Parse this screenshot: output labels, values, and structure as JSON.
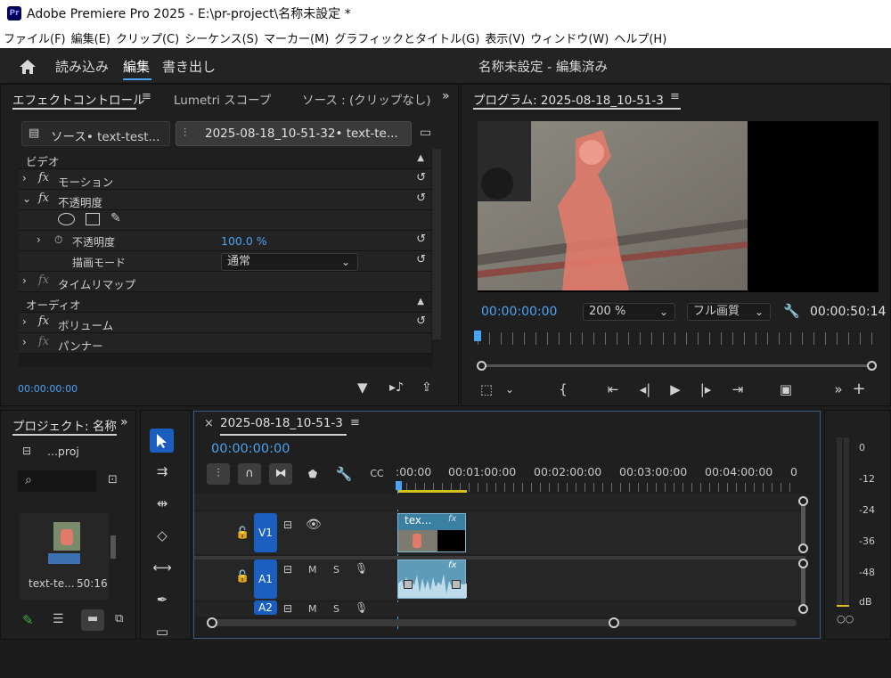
{
  "window": {
    "logo": "Pr",
    "title": "Adobe Premiere Pro 2025 - E:\\pr-project\\名称未設定 *"
  },
  "menu": [
    "ファイル(F)",
    "編集(E)",
    "クリップ(C)",
    "シーケンス(S)",
    "マーカー(M)",
    "グラフィックとタイトル(G)",
    "表示(V)",
    "ウィンドウ(W)",
    "ヘルプ(H)"
  ],
  "workspace": {
    "tabs": [
      "読み込み",
      "編集",
      "書き出し"
    ],
    "active_tab": "編集",
    "project_title": "名称未設定 - 編集済み"
  },
  "effect_controls": {
    "tabs": [
      "エフェクトコントロール",
      "Lumetri スコープ",
      "ソース : (クリップなし)"
    ],
    "source_chip": "ソース• text-test...",
    "sequence_chip": "2025-08-18_10-51-32• text-te...",
    "video_header": "ビデオ",
    "motion": "モーション",
    "opacity_group": "不透明度",
    "opacity_label": "不透明度",
    "opacity_value": "100.0 %",
    "blend_mode_label": "描画モード",
    "blend_mode_value": "通常",
    "time_remap": "タイムリマップ",
    "audio_header": "オーディオ",
    "volume": "ボリューム",
    "panner": "パンナー",
    "timecode": "00:00:00:00"
  },
  "program_monitor": {
    "title": "プログラム: 2025-08-18_10-51-3",
    "timecode": "00:00:00:00",
    "zoom": "200 %",
    "quality": "フル画質",
    "duration": "00:00:50:14"
  },
  "project_panel": {
    "title": "プロジェクト: 名称",
    "bin": "...proj",
    "item_name": "text-te...",
    "item_duration": "50:16"
  },
  "timeline": {
    "sequence_tab": "2025-08-18_10-51-3",
    "close": "×",
    "timecode": "00:00:00:00",
    "ruler": [
      ":00:00",
      "00:01:00:00",
      "00:02:00:00",
      "00:03:00:00",
      "00:04:00:00",
      "0"
    ],
    "tracks": {
      "v1": "V1",
      "a1": "A1",
      "a2": "A2",
      "mute": "M",
      "solo": "S"
    },
    "video_clip": "tex...",
    "clip_fx": "fx"
  },
  "audio_meter": {
    "scale": [
      "0",
      "-12",
      "-24",
      "-36",
      "-48",
      "dB"
    ]
  },
  "colors": {
    "accent_blue": "#4aa3f0",
    "track_blue": "#1a5fbf",
    "clip_blue": "#3b7fa3",
    "playhead_yellow": "#d4c21c"
  }
}
